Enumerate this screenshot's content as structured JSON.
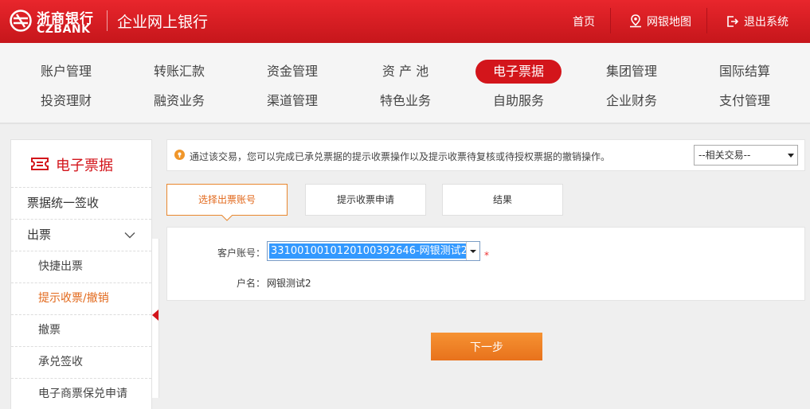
{
  "header": {
    "logo_cn": "浙商银行",
    "logo_en": "CZBANK",
    "app_title": "企业网上银行",
    "links": {
      "home": "首页",
      "map": "网银地图",
      "logout": "退出系统"
    }
  },
  "nav": {
    "row1": [
      "账户管理",
      "转账汇款",
      "资金管理",
      "资 产 池",
      "电子票据",
      "集团管理",
      "国际结算"
    ],
    "row2": [
      "投资理财",
      "融资业务",
      "渠道管理",
      "特色业务",
      "自助服务",
      "企业财务",
      "支付管理"
    ],
    "active": "电子票据"
  },
  "sidebar": {
    "title": "电子票据",
    "items": [
      {
        "label": "票据统一签收"
      },
      {
        "label": "出票"
      },
      {
        "label": "快捷出票"
      },
      {
        "label": "提示收票/撤销"
      },
      {
        "label": "撤票"
      },
      {
        "label": "承兑签收"
      },
      {
        "label": "电子商票保兑申请"
      }
    ]
  },
  "info": {
    "text": "通过该交易，您可以完成已承兑票据的提示收票操作以及提示收票待复核或待授权票据的撤销操作。",
    "related_select": "--相关交易--"
  },
  "steps": [
    "选择出票账号",
    "提示收票申请",
    "结果"
  ],
  "form": {
    "account_label": "客户账号：",
    "account_value": "33100100101201003926​46-网银测试2",
    "required_mark": "*",
    "name_label": "户名：",
    "name_value": "网银测试2"
  },
  "buttons": {
    "next": "下一步"
  },
  "colors": {
    "brand_red": "#d3151b",
    "accent_orange": "#e8721c",
    "selection_blue": "#3399ff"
  }
}
